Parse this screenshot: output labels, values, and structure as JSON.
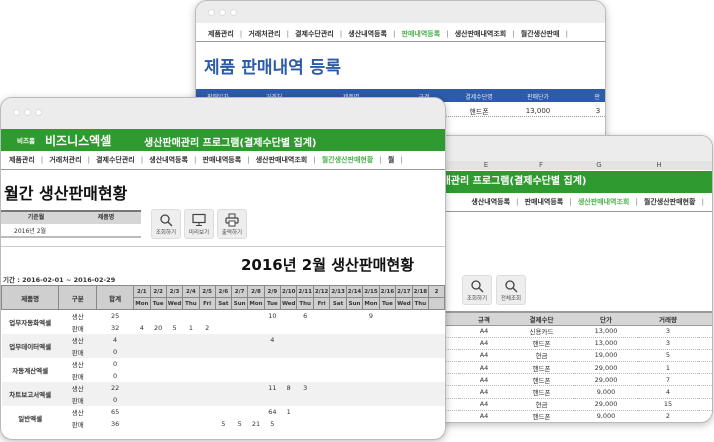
{
  "back_window": {
    "menu": [
      {
        "label": "제품관리"
      },
      {
        "label": "거래처관리"
      },
      {
        "label": "결제수단관리"
      },
      {
        "label": "생산내역등록"
      },
      {
        "label": "판매내역등록",
        "active": true
      },
      {
        "label": "생산판매내역조회"
      },
      {
        "label": "월간생산판매"
      }
    ],
    "title": "제품 판매내역 등록",
    "headers": [
      "판매일자",
      "거래처",
      "제품명",
      "규격",
      "결제수단명",
      "판매단가",
      "판매"
    ],
    "row": [
      "핸드폰",
      "13,000",
      "3"
    ]
  },
  "right_window": {
    "col_letters": [
      "E",
      "F",
      "G",
      "H"
    ],
    "program_title": "생산판매관리 프로그램(결제수단별 집계)",
    "menu": [
      {
        "label": "생산내역등록"
      },
      {
        "label": "판매내역등록"
      },
      {
        "label": "생산판매내역조회",
        "active": true
      },
      {
        "label": "월간생산판매현황"
      }
    ],
    "buttons": {
      "search": "조회하기",
      "search_all": "전체조회"
    },
    "headers": [
      "규격",
      "결제수단",
      "단가",
      "거래량"
    ],
    "rows": [
      [
        "A4",
        "신용카드",
        "13,000",
        "3"
      ],
      [
        "A4",
        "핸드폰",
        "13,000",
        "3"
      ],
      [
        "A4",
        "현금",
        "19,000",
        "5"
      ],
      [
        "A4",
        "핸드폰",
        "29,000",
        "1"
      ],
      [
        "A4",
        "핸드폰",
        "29,000",
        "7"
      ],
      [
        "A4",
        "핸드폰",
        "9,000",
        "4"
      ],
      [
        "A4",
        "현금",
        "29,000",
        "15"
      ],
      [
        "A4",
        "핸드폰",
        "9,000",
        "2"
      ]
    ]
  },
  "front_window": {
    "brand_small": "비즈폼",
    "brand": "비즈니스엑셀",
    "program_title": "생산판매관리 프로그램(결제수단별 집계)",
    "menu": [
      {
        "label": "제품관리"
      },
      {
        "label": "거래처관리"
      },
      {
        "label": "결제수단관리"
      },
      {
        "label": "생산내역등록"
      },
      {
        "label": "판매내역등록"
      },
      {
        "label": "생산판매내역조회"
      },
      {
        "label": "월간생산판매현황",
        "active": true
      },
      {
        "label": "월"
      }
    ],
    "page_title": "월간 생산판매현황",
    "filter": {
      "month_label": "기준월",
      "product_label": "제품명",
      "month_value": "2016년 2월",
      "product_value": ""
    },
    "buttons": {
      "search": "조회하기",
      "preview": "미리보기",
      "print": "출력하기"
    },
    "report_title": "2016년 2월 생산판매현황",
    "period": "기간 : 2016-02-01 ~ 2016-02-29",
    "headers": {
      "product": "제품명",
      "type": "구분",
      "total": "합계"
    },
    "days": [
      [
        "2/1",
        "Mon"
      ],
      [
        "2/2",
        "Tue"
      ],
      [
        "2/3",
        "Wed"
      ],
      [
        "2/4",
        "Thu"
      ],
      [
        "2/5",
        "Fri"
      ],
      [
        "2/6",
        "Sat"
      ],
      [
        "2/7",
        "Sun"
      ],
      [
        "2/8",
        "Mon"
      ],
      [
        "2/9",
        "Tue"
      ],
      [
        "2/10",
        "Wed"
      ],
      [
        "2/11",
        "Thu"
      ],
      [
        "2/12",
        "Fri"
      ],
      [
        "2/13",
        "Sat"
      ],
      [
        "2/14",
        "Sun"
      ],
      [
        "2/15",
        "Mon"
      ],
      [
        "2/16",
        "Tue"
      ],
      [
        "2/17",
        "Wed"
      ],
      [
        "2/18",
        "Thu"
      ],
      [
        "2",
        ""
      ]
    ],
    "products": [
      {
        "name": "업무자동화엑셀",
        "rows": [
          {
            "type": "생산",
            "total": "25",
            "vals": {
              "2/9": "10",
              "2/11": "6",
              "2/15": "9"
            }
          },
          {
            "type": "판매",
            "total": "32",
            "vals": {
              "2/1": "4",
              "2/2": "20",
              "2/3": "5",
              "2/4": "1",
              "2/5": "2"
            }
          }
        ]
      },
      {
        "name": "업무데이터엑셀",
        "rows": [
          {
            "type": "생산",
            "total": "4",
            "vals": {
              "2/9": "4"
            }
          },
          {
            "type": "판매",
            "total": "0",
            "vals": {}
          }
        ]
      },
      {
        "name": "자동계산엑셀",
        "rows": [
          {
            "type": "생산",
            "total": "0",
            "vals": {}
          },
          {
            "type": "판매",
            "total": "0",
            "vals": {}
          }
        ]
      },
      {
        "name": "차트보고서엑셀",
        "rows": [
          {
            "type": "생산",
            "total": "22",
            "vals": {
              "2/9": "11",
              "2/10": "8",
              "2/11": "3"
            }
          },
          {
            "type": "판매",
            "total": "0",
            "vals": {}
          }
        ]
      },
      {
        "name": "일반엑셀",
        "rows": [
          {
            "type": "생산",
            "total": "65",
            "vals": {
              "2/9": "64",
              "2/10": "1"
            }
          },
          {
            "type": "판매",
            "total": "36",
            "vals": {
              "2/6": "5",
              "2/7": "5",
              "2/8": "21",
              "2/9": "5"
            }
          }
        ]
      }
    ]
  },
  "colors": {
    "green": "#2f9a2f",
    "blue": "#2d5ba8",
    "active_menu": "#4cb04c"
  }
}
